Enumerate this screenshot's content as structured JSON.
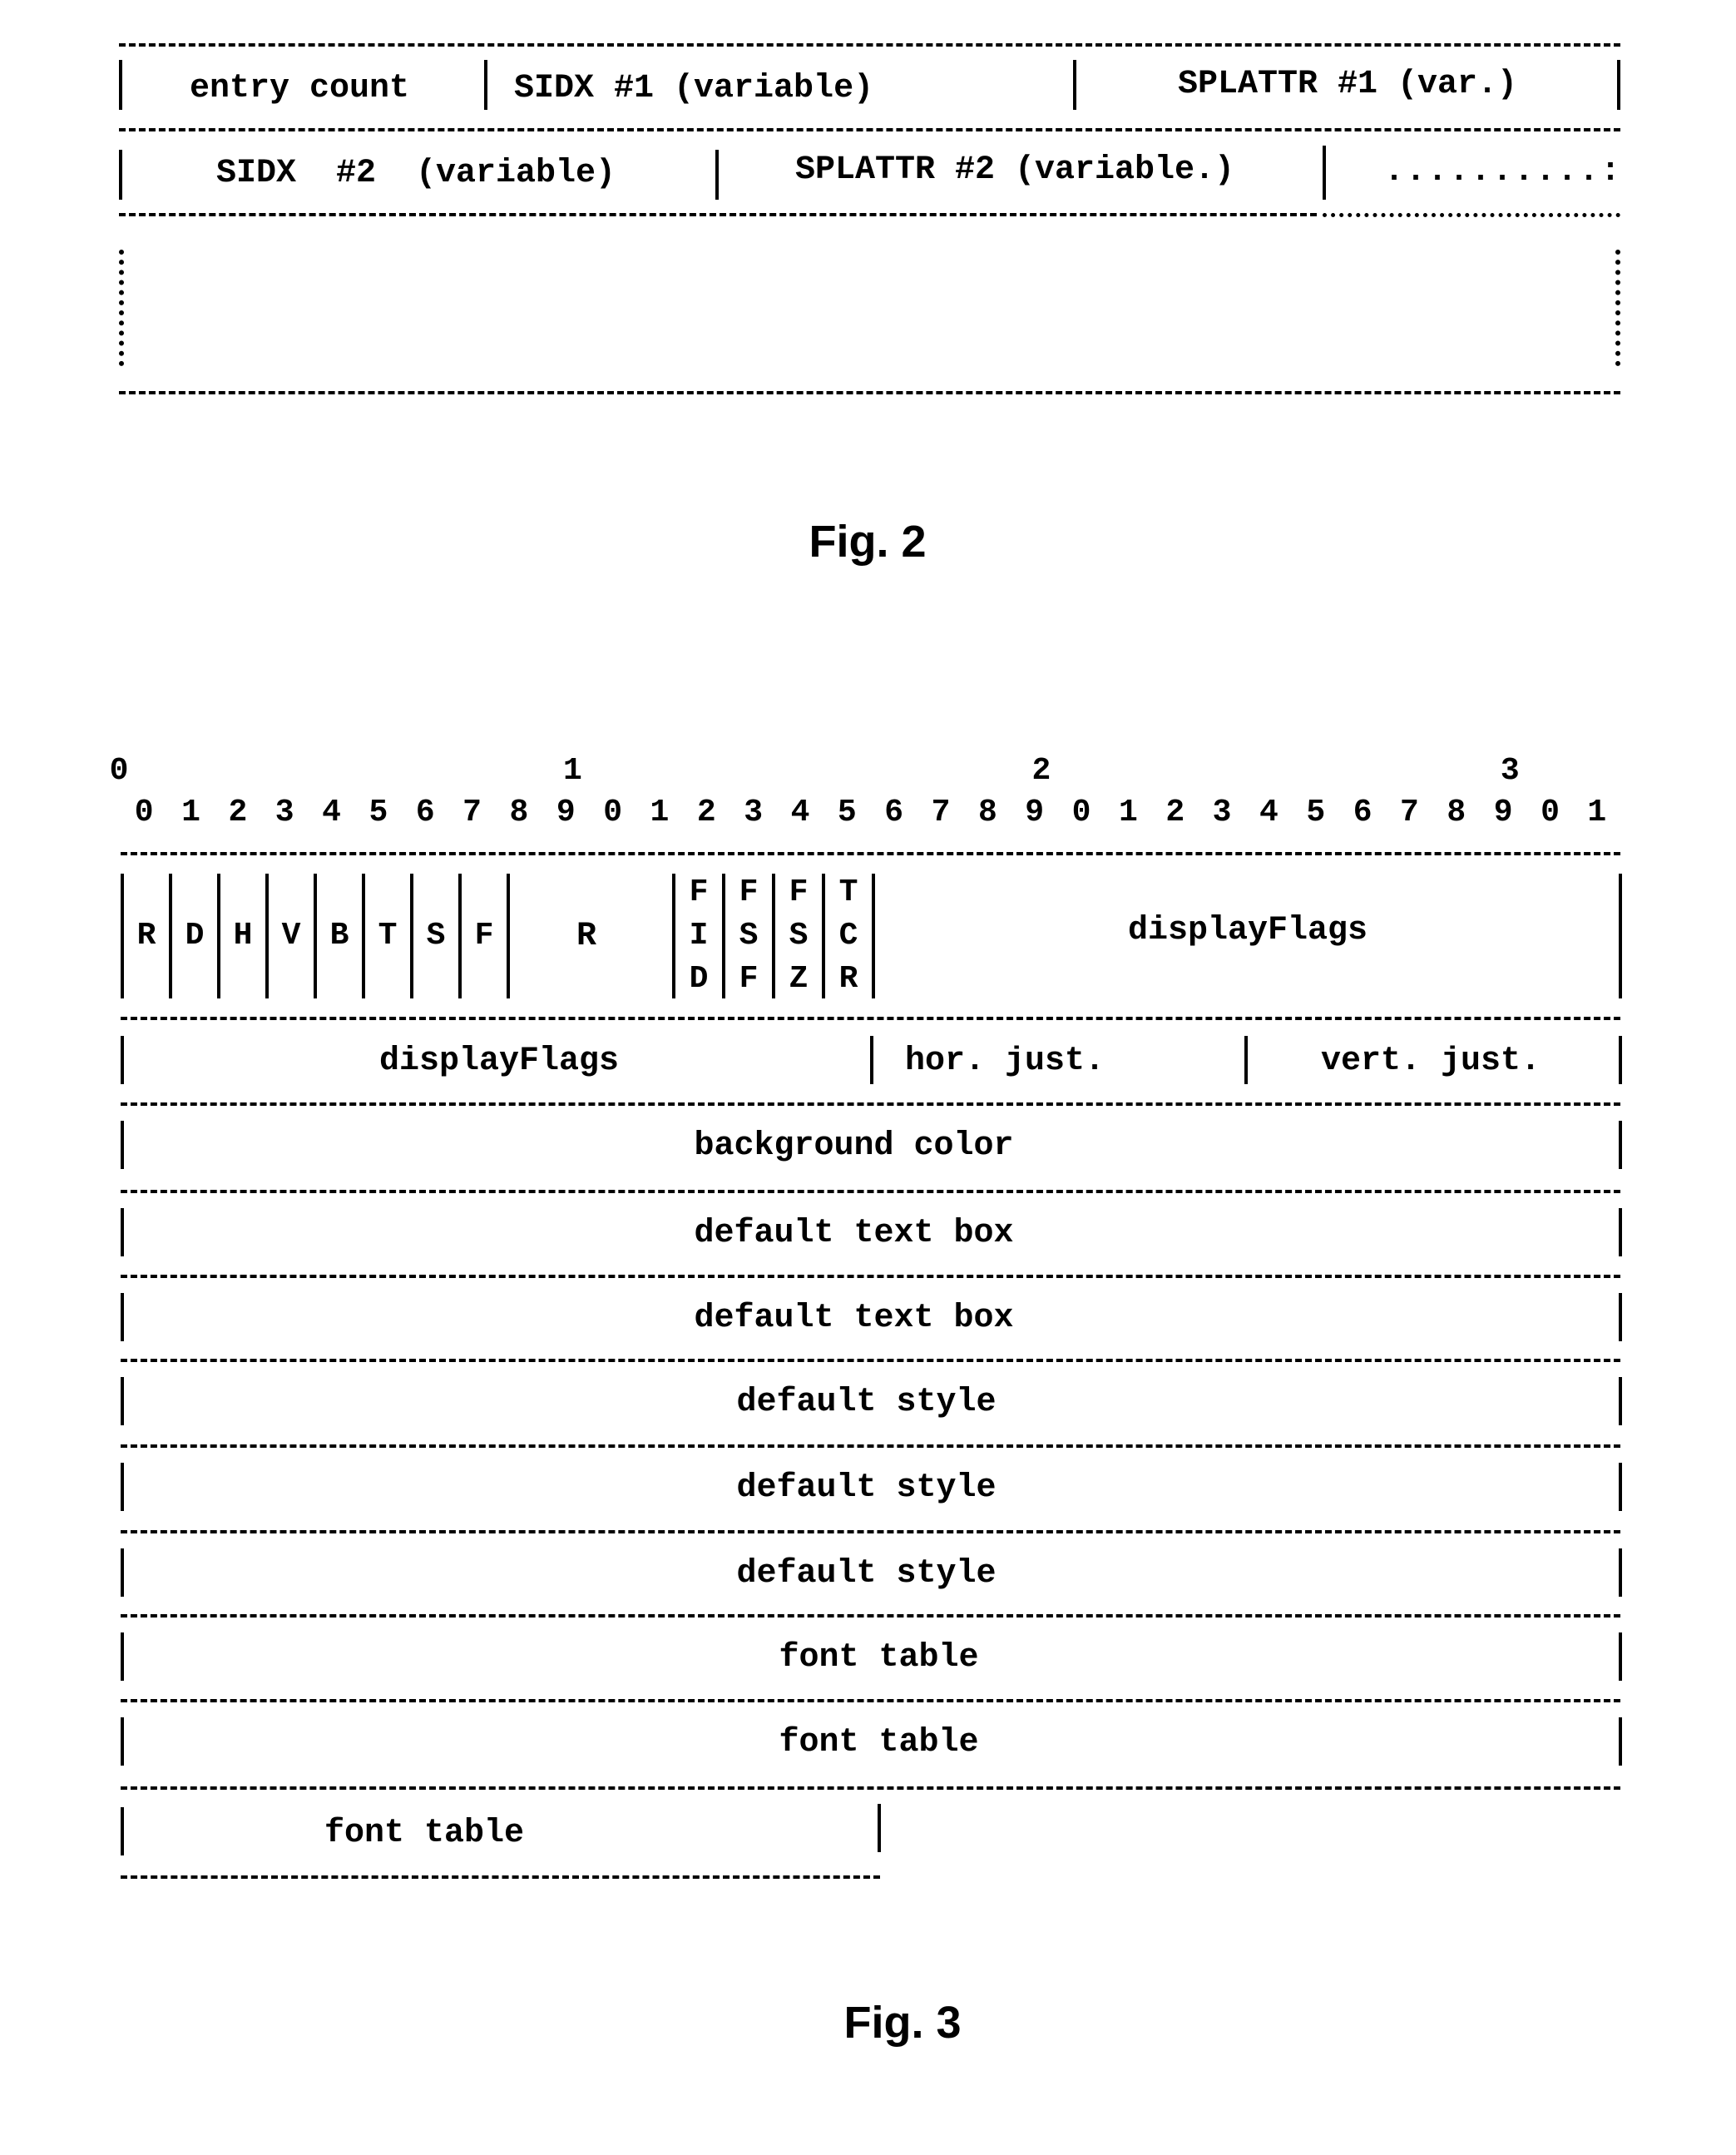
{
  "fig2": {
    "caption": "Fig. 2",
    "rows": [
      {
        "fields": [
          {
            "label": "entry count"
          },
          {
            "label": "SIDX #1 (variable)"
          },
          {
            "label": "SPLATTR #1 (var.)"
          }
        ]
      },
      {
        "fields": [
          {
            "label": "SIDX  #2  (variable)"
          },
          {
            "label": "SPLATTR #2 (variable.)"
          },
          {
            "label": "..........:"
          }
        ]
      }
    ],
    "continuation": ":"
  },
  "fig3": {
    "caption": "Fig. 3",
    "bit_tens": [
      "0",
      "1",
      "2",
      "3"
    ],
    "bit_units": [
      "0",
      "1",
      "2",
      "3",
      "4",
      "5",
      "6",
      "7",
      "8",
      "9",
      "0",
      "1",
      "2",
      "3",
      "4",
      "5",
      "6",
      "7",
      "8",
      "9",
      "0",
      "1",
      "2",
      "3",
      "4",
      "5",
      "6",
      "7",
      "8",
      "9",
      "0",
      "1"
    ],
    "flags": [
      "R",
      "D",
      "H",
      "V",
      "B",
      "T",
      "S",
      "F"
    ],
    "reserved": "R",
    "stacked_flags": [
      [
        "F",
        "I",
        "D"
      ],
      [
        "F",
        "S",
        "F"
      ],
      [
        "F",
        "S",
        "Z"
      ],
      [
        "T",
        "C",
        "R"
      ]
    ],
    "row1_tail": "displayFlags",
    "row2": {
      "display_flags": "displayFlags",
      "hor_just": "hor. just.",
      "vert_just": "vert. just."
    },
    "full_rows": [
      "background color",
      "default text box",
      "default text box",
      "default style",
      "default style",
      "default style",
      "font table",
      "font table"
    ],
    "last_row": "font table"
  }
}
